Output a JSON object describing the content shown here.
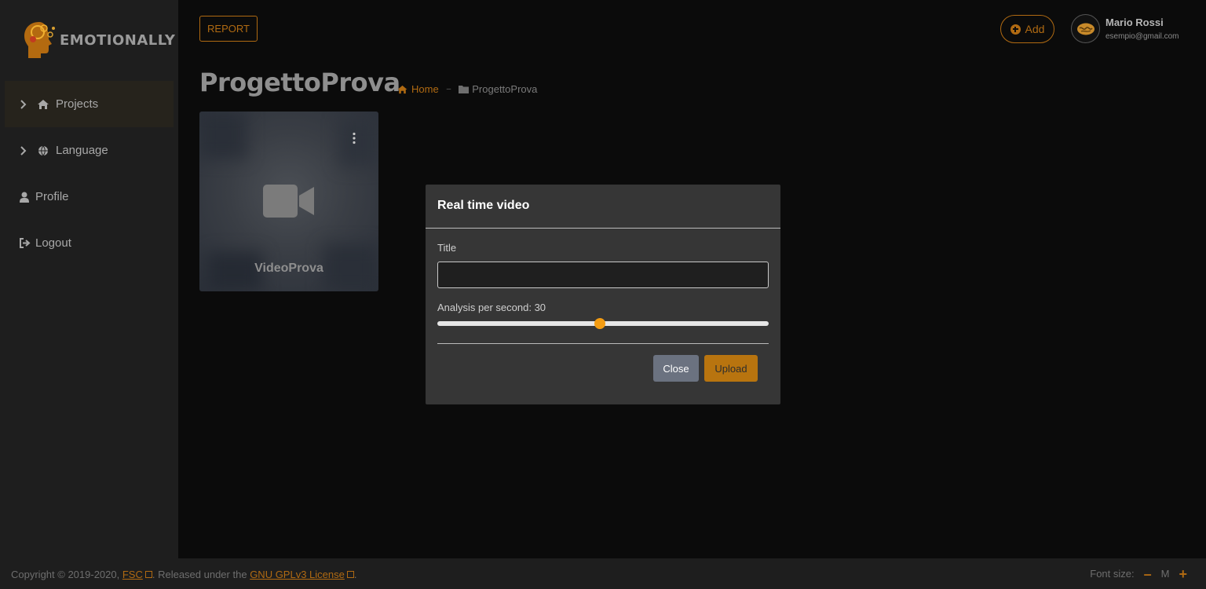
{
  "brand": {
    "name": "EMOTIONALLY"
  },
  "sidebar": {
    "items": [
      {
        "label": "Projects",
        "icon": "home-icon",
        "has_chevron": true,
        "active": true
      },
      {
        "label": "Language",
        "icon": "globe-icon",
        "has_chevron": true,
        "active": false
      },
      {
        "label": "Profile",
        "icon": "user-icon",
        "has_chevron": false,
        "active": false
      },
      {
        "label": "Logout",
        "icon": "logout-icon",
        "has_chevron": false,
        "active": false
      }
    ]
  },
  "header": {
    "report_label": "REPORT",
    "add_label": "Add",
    "user": {
      "name": "Mario Rossi",
      "email": "esempio@gmail.com"
    }
  },
  "page": {
    "title": "ProgettoProva",
    "breadcrumb": {
      "home": "Home",
      "separator": "–",
      "current": "ProgettoProva"
    }
  },
  "cards": [
    {
      "title": "VideoProva",
      "icon": "video-camera-icon"
    }
  ],
  "modal": {
    "title": "Real time video",
    "title_field_label": "Title",
    "title_field_value": "",
    "analysis_label": "Analysis per second: 30",
    "analysis_value": 30,
    "analysis_fraction": 0.49,
    "close_label": "Close",
    "upload_label": "Upload"
  },
  "footer": {
    "copyright_prefix": "Copyright © 2019-2020,",
    "fsc_link": "FSC",
    "released_text": ". Released under the",
    "license_link": "GNU GPLv3 License",
    "end_text": ".",
    "font_size_label": "Font size:",
    "font_decrease": "–",
    "font_current": "M",
    "font_increase": "+"
  },
  "colors": {
    "accent": "#b06a12",
    "slider_thumb": "#f39c12",
    "upload_bg": "#b8740f",
    "close_bg": "#6b7280"
  }
}
